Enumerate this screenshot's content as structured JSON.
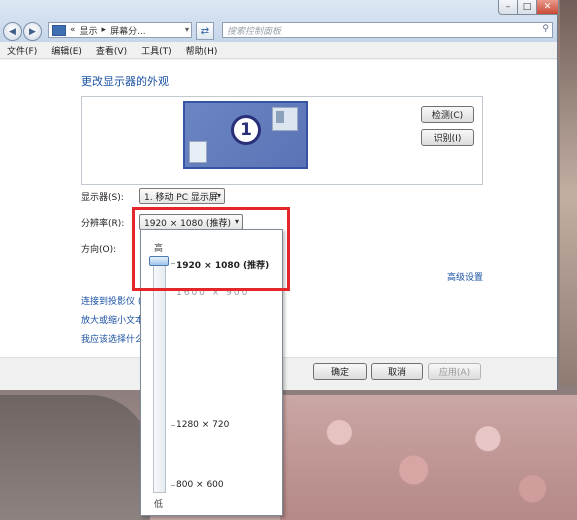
{
  "address": {
    "chevrons": "«",
    "crumb1": "显示",
    "sep": "▸",
    "crumb2": "屏幕分..."
  },
  "search": {
    "placeholder": "搜索控制面板"
  },
  "menu": [
    "文件(F)",
    "编辑(E)",
    "查看(V)",
    "工具(T)",
    "帮助(H)"
  ],
  "main": {
    "heading": "更改显示器的外观",
    "monitor_number": "1",
    "detect_label": "检测(C)",
    "identify_label": "识别(I)",
    "display_label": "显示器(S):",
    "display_value": "1. 移动 PC 显示屏",
    "resolution_label": "分辨率(R):",
    "resolution_value": "1920 × 1080 (推荐)",
    "orientation_label": "方向(O):",
    "advanced_link": "高级设置",
    "link_projector": "连接到投影仪 (",
    "link_textsize": "放大或缩小文本",
    "link_settings": "我应该选择什么"
  },
  "footer": {
    "ok_label": "确定",
    "cancel_label": "取消",
    "apply_label": "应用(A)"
  },
  "dropdown": {
    "high_label": "高",
    "low_label": "低",
    "options": [
      "1920 × 1080 (推荐)",
      "1280 × 720",
      "800 × 600"
    ],
    "partial_option": "1600 × 900",
    "selected_fraction_from_top": 0.0
  }
}
